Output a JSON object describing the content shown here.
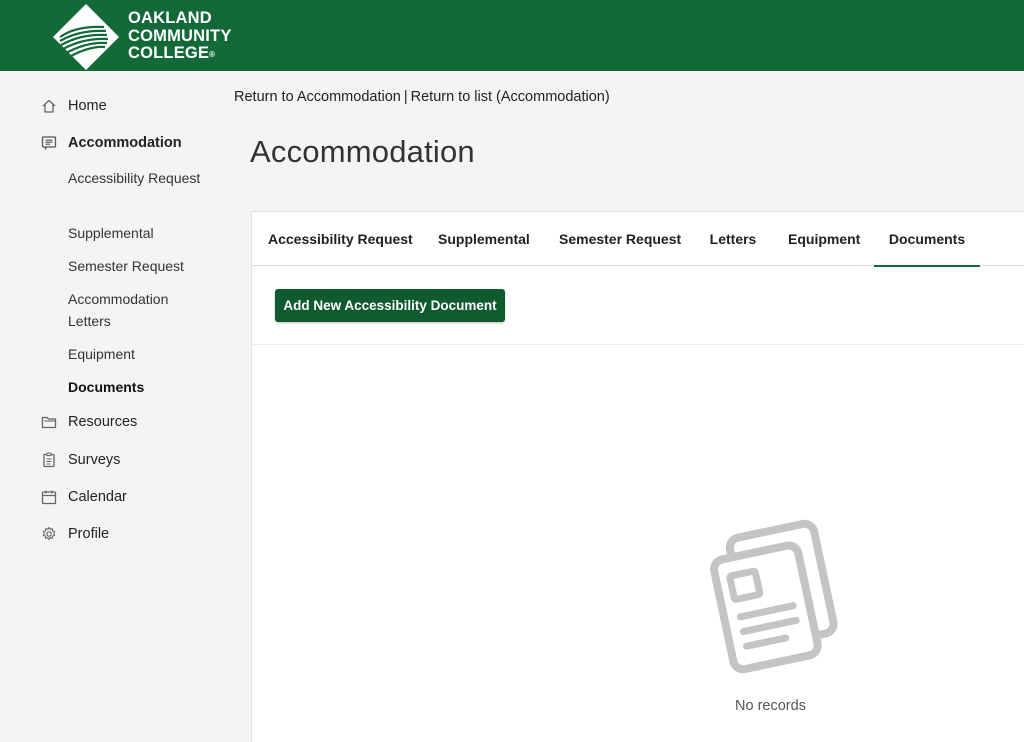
{
  "header": {
    "logo_lines": [
      "OAKLAND",
      "COMMUNITY",
      "COLLEGE"
    ],
    "registered_mark": "®"
  },
  "sidebar": {
    "items": [
      {
        "label": "Home",
        "icon": "home-icon"
      },
      {
        "label": "Accommodation",
        "icon": "message-list-icon"
      },
      {
        "label": "Resources",
        "icon": "folder-icon"
      },
      {
        "label": "Surveys",
        "icon": "clipboard-icon"
      },
      {
        "label": "Calendar",
        "icon": "calendar-icon"
      },
      {
        "label": "Profile",
        "icon": "gear-icon"
      }
    ],
    "sub_items": [
      {
        "label": "Accessibility Request"
      },
      {
        "label": "Supplemental"
      },
      {
        "label": "Semester Request"
      },
      {
        "label": "Accommodation Letters"
      },
      {
        "label": "Equipment"
      },
      {
        "label": "Documents"
      }
    ]
  },
  "breadcrumb": {
    "link1": "Return to Accommodation",
    "separator": "|",
    "link2": "Return to list (Accommodation)"
  },
  "page": {
    "title": "Accommodation"
  },
  "tabs": [
    {
      "label": "Accessibility Request"
    },
    {
      "label": "Supplemental"
    },
    {
      "label": "Semester Request"
    },
    {
      "label": "Letters"
    },
    {
      "label": "Equipment"
    },
    {
      "label": "Documents"
    }
  ],
  "content": {
    "add_button_label": "Add New Accessibility Document",
    "empty_text": "No records",
    "empty_icon": "documents-icon"
  },
  "colors": {
    "brand_green": "#136a38",
    "button_green": "#0f5a2f",
    "empty_icon_gray": "#c4c4c4"
  }
}
